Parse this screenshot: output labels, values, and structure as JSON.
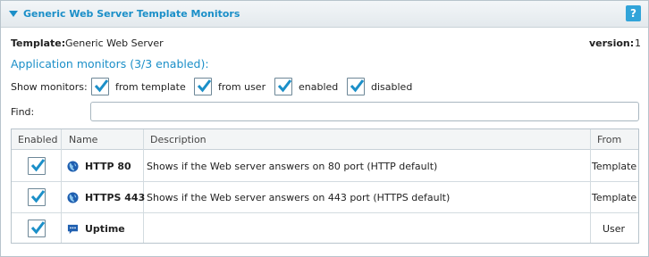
{
  "header": {
    "title": "Generic Web Server Template Monitors",
    "help_label": "?"
  },
  "template": {
    "label": "Template:",
    "value": "Generic Web Server",
    "version_label": "version:",
    "version_value": "1"
  },
  "app_monitors_title": "Application monitors (3/3 enabled):",
  "show_monitors": {
    "label": "Show monitors:",
    "options": [
      {
        "label": "from template",
        "checked": true
      },
      {
        "label": "from user",
        "checked": true
      },
      {
        "label": "enabled",
        "checked": true
      },
      {
        "label": "disabled",
        "checked": true
      }
    ]
  },
  "find": {
    "label": "Find:",
    "value": ""
  },
  "table": {
    "columns": [
      "Enabled",
      "Name",
      "Description",
      "From"
    ],
    "rows": [
      {
        "enabled": true,
        "icon": "globe-icon",
        "name": "HTTP 80",
        "description": "Shows if the Web server answers on 80 port (HTTP default)",
        "from": "Template"
      },
      {
        "enabled": true,
        "icon": "globe-icon",
        "name": "HTTPS 443",
        "description": "Shows if the Web server answers on 443 port (HTTPS default)",
        "from": "Template"
      },
      {
        "enabled": true,
        "icon": "chat-icon",
        "name": "Uptime",
        "description": "",
        "from": "User"
      }
    ]
  },
  "colors": {
    "accent": "#1b8fc8",
    "border": "#b8c4cc"
  }
}
